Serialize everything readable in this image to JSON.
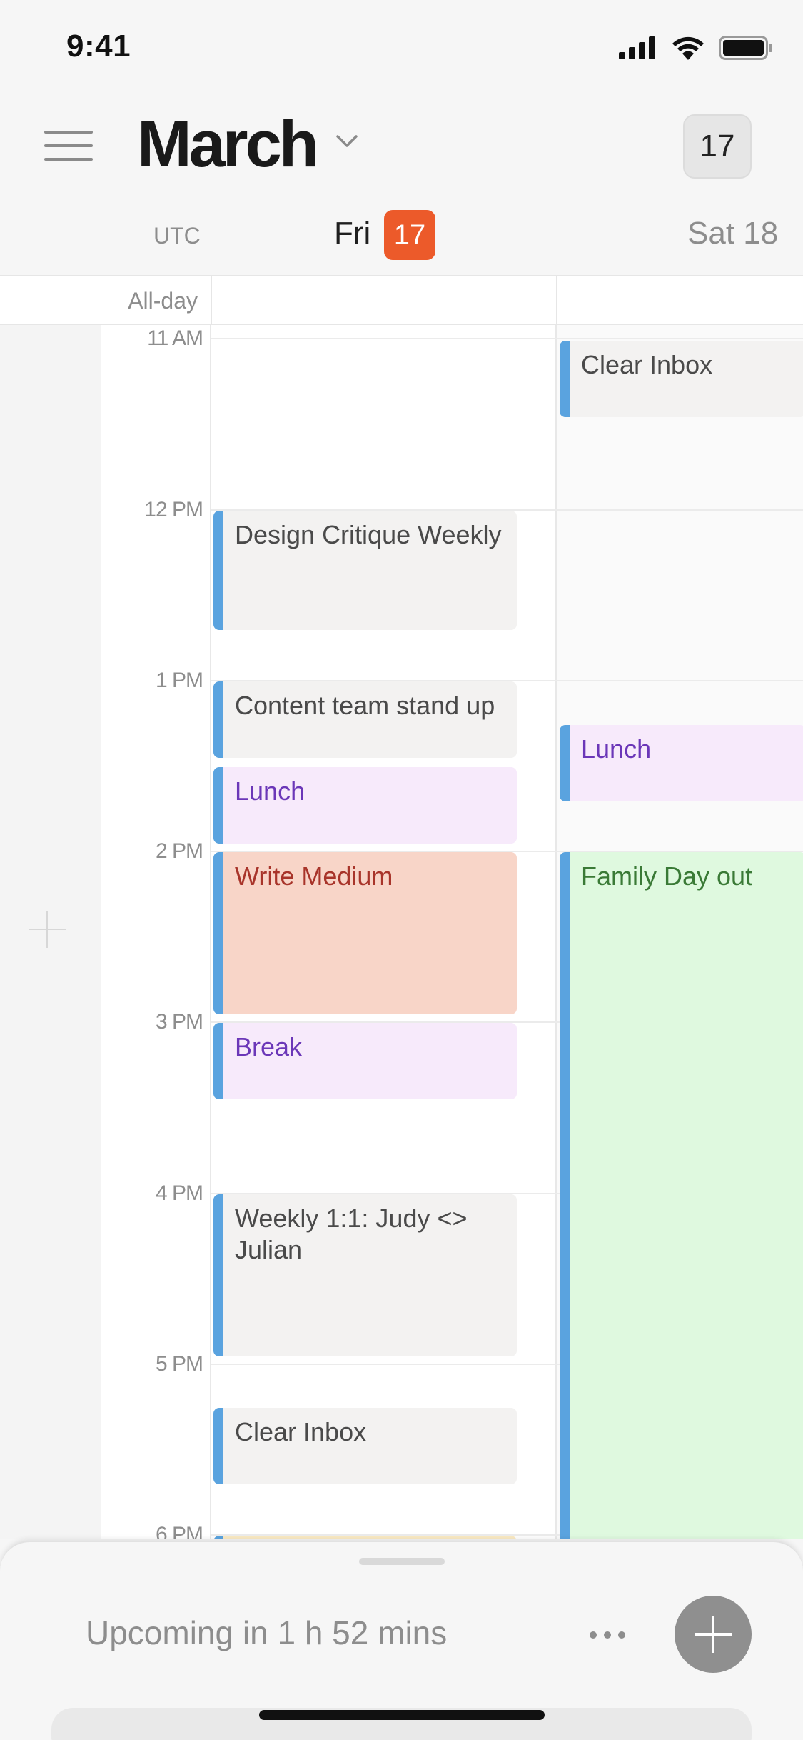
{
  "status_bar": {
    "time": "9:41"
  },
  "header": {
    "month": "March",
    "today_button": "17"
  },
  "day_header": {
    "timezone": "UTC",
    "day1_name": "Fri",
    "day1_date": "17",
    "day2_label": "Sat 18"
  },
  "allday": {
    "label": "All-day"
  },
  "time_labels": [
    "11 AM",
    "12 PM",
    "1 PM",
    "2 PM",
    "3 PM",
    "4 PM",
    "5 PM",
    "6 PM"
  ],
  "events": {
    "fri": [
      {
        "title": "Design Critique Weekly",
        "color": "gray"
      },
      {
        "title": "Content team stand up",
        "color": "gray"
      },
      {
        "title": "Lunch",
        "color": "purple"
      },
      {
        "title": "Write Medium",
        "color": "salmon"
      },
      {
        "title": "Break",
        "color": "purple"
      },
      {
        "title": "Weekly 1:1: Judy <> Julian",
        "color": "gray"
      },
      {
        "title": "Clear Inbox",
        "color": "gray"
      }
    ],
    "sat": [
      {
        "title": "Clear Inbox",
        "color": "gray"
      },
      {
        "title": "Lunch",
        "color": "purple"
      },
      {
        "title": "Family Day out",
        "color": "green"
      }
    ]
  },
  "bottom_sheet": {
    "upcoming": "Upcoming in 1 h 52 mins"
  },
  "colors": {
    "accent_today": "#ec5a2a",
    "event_bar": "#5aa3df",
    "purple_text": "#6b37b8",
    "salmon_bg": "#f8d5c8",
    "green_bg": "#dff9df"
  }
}
